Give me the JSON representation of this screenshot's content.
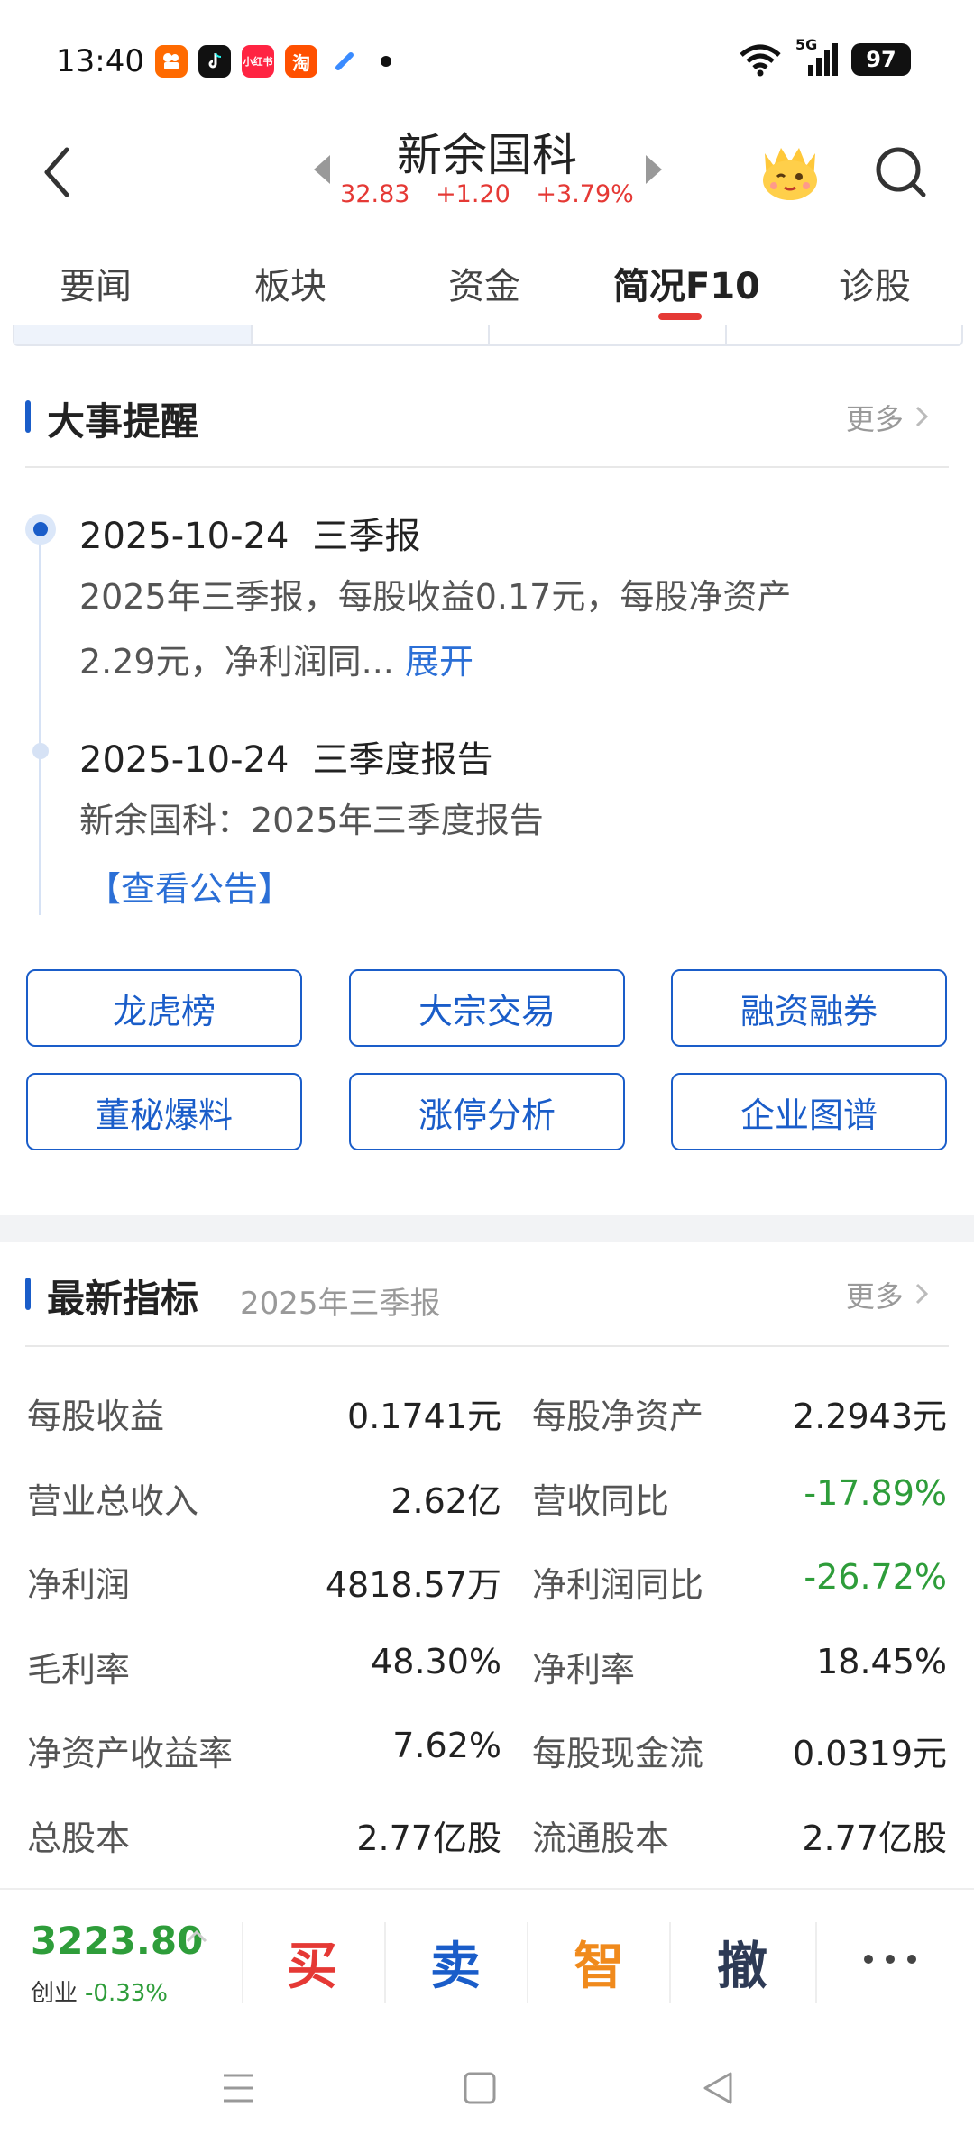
{
  "status_bar": {
    "time": "13:40",
    "apps": [
      {
        "icon": "kuaishou-icon",
        "color": "#ff6a00",
        "label": ""
      },
      {
        "icon": "tiktok-icon",
        "color": "#111111",
        "label": ""
      },
      {
        "icon": "xiaohongshu-icon",
        "color": "#ff2442",
        "label": "小红书"
      },
      {
        "icon": "taobao-icon",
        "color": "#ff5000",
        "label": "淘"
      },
      {
        "icon": "browser-icon",
        "color": "#3a8bff",
        "label": ""
      }
    ],
    "network": "5G",
    "battery": "97"
  },
  "header": {
    "stock_name": "新余国科",
    "price": "32.83",
    "change": "+1.20",
    "change_pct": "+3.79%",
    "quote_color": "#e53935"
  },
  "tabs": [
    {
      "label": "要闻",
      "active": false
    },
    {
      "label": "板块",
      "active": false
    },
    {
      "label": "资金",
      "active": false
    },
    {
      "label": "简况F10",
      "active": true
    },
    {
      "label": "诊股",
      "active": false
    }
  ],
  "events_section": {
    "title": "大事提醒",
    "more": "更多",
    "events": [
      {
        "date": "2025-10-24",
        "type": "三季报",
        "line1": "2025年三季报，每股收益0.17元，每股净资产",
        "line2": "2.29元，净利润同...",
        "expand": "展开"
      },
      {
        "date": "2025-10-24",
        "type": "三季度报告",
        "line1": "新余国科：2025年三季度报告",
        "notice": "【查看公告】"
      }
    ]
  },
  "quick_buttons": [
    "龙虎榜",
    "大宗交易",
    "融资融券",
    "董秘爆料",
    "涨停分析",
    "企业图谱"
  ],
  "metrics_section": {
    "title": "最新指标",
    "subtitle": "2025年三季报",
    "more": "更多",
    "rows": [
      {
        "l_label": "每股收益",
        "l_value": "0.1741元",
        "r_label": "每股净资产",
        "r_value": "2.2943元",
        "r_color": "normal"
      },
      {
        "l_label": "营业总收入",
        "l_value": "2.62亿",
        "r_label": "营收同比",
        "r_value": "-17.89%",
        "r_color": "green"
      },
      {
        "l_label": "净利润",
        "l_value": "4818.57万",
        "r_label": "净利润同比",
        "r_value": "-26.72%",
        "r_color": "green"
      },
      {
        "l_label": "毛利率",
        "l_value": "48.30%",
        "r_label": "净利率",
        "r_value": "18.45%",
        "r_color": "normal"
      },
      {
        "l_label": "净资产收益率",
        "l_value": "7.62%",
        "r_label": "每股现金流",
        "r_value": "0.0319元",
        "r_color": "normal"
      },
      {
        "l_label": "总股本",
        "l_value": "2.77亿股",
        "r_label": "流通股本",
        "r_value": "2.77亿股",
        "r_color": "normal"
      }
    ]
  },
  "bottom_bar": {
    "index_value": "3223.80",
    "index_name": "创业",
    "index_change": "-0.33%",
    "buy": "买",
    "sell": "卖",
    "smart": "智",
    "cancel": "撤",
    "buy_color": "#e53935",
    "sell_color": "#1a5dc9",
    "smart_color": "#f08a1c",
    "cancel_color": "#2d3a55"
  }
}
